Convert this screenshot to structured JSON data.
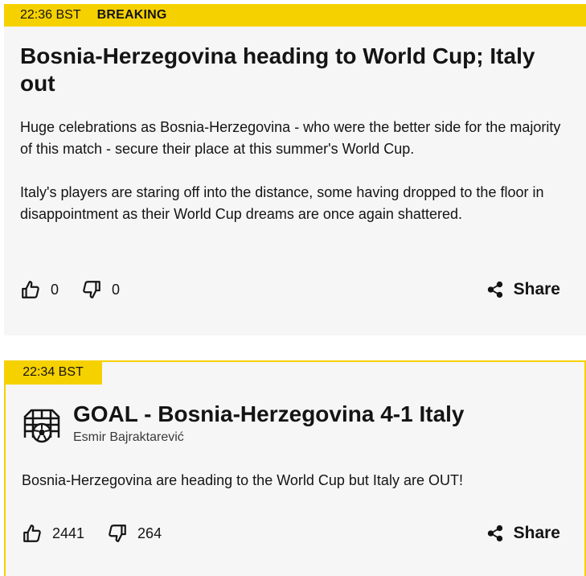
{
  "post1": {
    "time": "22:36 BST",
    "badge": "BREAKING",
    "headline": "Bosnia-Herzegovina heading to World Cup; Italy out",
    "paragraphs": [
      "Huge celebrations as Bosnia-Herzegovina - who were the better side for the majority of this match - secure their place at this summer's World Cup.",
      "Italy's players are staring off into the distance, some having dropped to the floor in disappointment as their World Cup dreams are once again shattered."
    ],
    "likes": "0",
    "dislikes": "0",
    "share_label": "Share"
  },
  "post2": {
    "time": "22:34 BST",
    "headline": "GOAL - Bosnia-Herzegovina 4-1 Italy",
    "author": "Esmir Bajraktarević",
    "paragraph": "Bosnia-Herzegovina are heading to the World Cup but Italy are OUT!",
    "likes": "2441",
    "dislikes": "264",
    "share_label": "Share"
  },
  "colors": {
    "accent": "#f6d100",
    "card_bg": "#f6f6f6",
    "text": "#141414"
  },
  "icons": [
    "thumbs-up-icon",
    "thumbs-down-icon",
    "share-icon",
    "goal-net-ball-icon"
  ]
}
